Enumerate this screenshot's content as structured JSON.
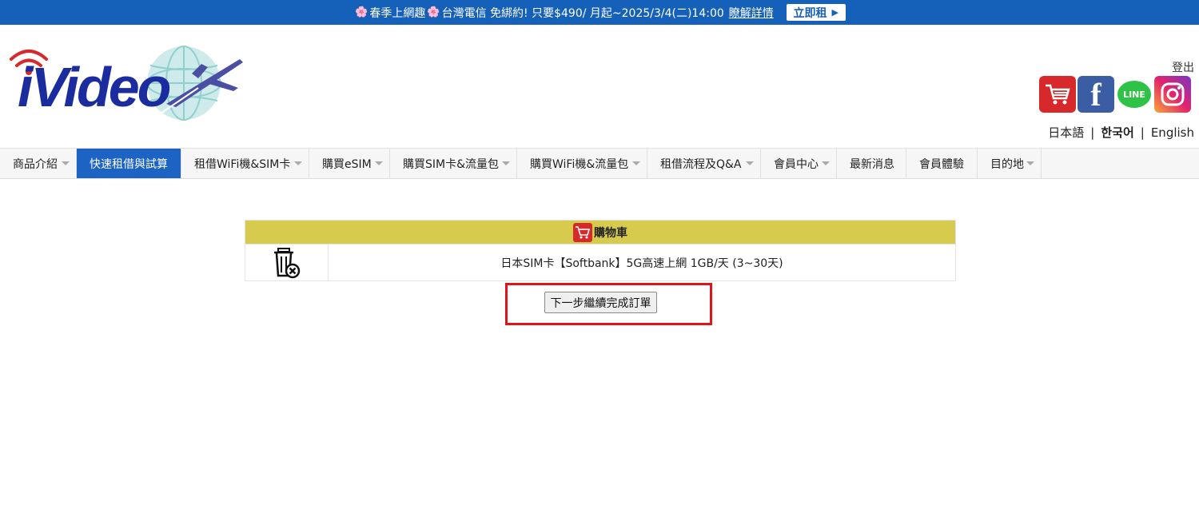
{
  "promo": {
    "flower": "🌸",
    "text1": "春季上網趣",
    "text2": "台灣電信 免綁約! 只要$490/ 月起~2025/3/4(二)14:00",
    "link": "瞭解詳情",
    "button": "立即租",
    "background": "#1560b8"
  },
  "header": {
    "logo_text": "iVideo",
    "logout": "登出",
    "social": {
      "cart_icon": "shopping-cart-icon",
      "facebook": "f",
      "line": "LINE",
      "instagram_icon": "instagram-icon"
    },
    "languages": [
      "日本語",
      "한국어",
      "English"
    ],
    "separator": "|"
  },
  "nav": {
    "items": [
      "商品介紹",
      "快速租借與試算",
      "租借WiFi機&SIM卡",
      "購買eSIM",
      "購買SIM卡&流量包",
      "購買WiFi機&流量包",
      "租借流程及Q&A",
      "會員中心",
      "最新消息",
      "會員體驗",
      "目的地"
    ],
    "active_index": 1,
    "accent": "#1c63c3"
  },
  "cart": {
    "title": "購物車",
    "header_color": "#d6cb4d",
    "delete_icon": "trash-remove-icon",
    "product": "日本SIM卡【Softbank】5G高速上網 1GB/天 (3~30天)"
  },
  "actions": {
    "next": "下一步繼續完成訂單",
    "highlight_color": "#e0141a"
  }
}
